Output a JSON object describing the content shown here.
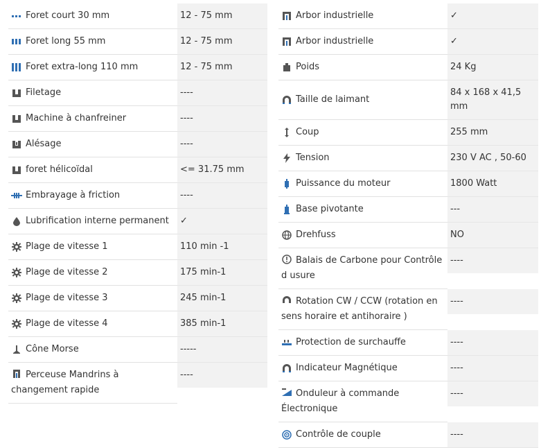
{
  "left": [
    {
      "label": "Foret court 30 mm",
      "value": "12 - 75 mm",
      "icon": "short-drill-icon"
    },
    {
      "label": "Foret long 55 mm",
      "value": "12 - 75 mm",
      "icon": "long-drill-icon"
    },
    {
      "label": "Foret extra-long 110 mm",
      "value": "12 - 75 mm",
      "icon": "extra-long-drill-icon"
    },
    {
      "label": "Filetage",
      "value": "----",
      "icon": "threading-icon"
    },
    {
      "label": "Machine à chanfreiner",
      "value": "----",
      "icon": "chamfer-icon"
    },
    {
      "label": "Alésage",
      "value": "----",
      "icon": "reaming-icon"
    },
    {
      "label": "foret hélicoïdal",
      "value": "<= 31.75 mm",
      "icon": "twist-drill-icon"
    },
    {
      "label": "Embrayage à friction",
      "value": "----",
      "icon": "friction-clutch-icon"
    },
    {
      "label": "Lubrification interne permanent",
      "value": "✓",
      "icon": "droplet-icon"
    },
    {
      "label": "Plage de vitesse 1",
      "value": "110 min -1",
      "icon": "gear-icon"
    },
    {
      "label": "Plage de vitesse 2",
      "value": "175 min-1",
      "icon": "gear-icon"
    },
    {
      "label": "Plage de vitesse 3",
      "value": "245 min-1",
      "icon": "gear-icon"
    },
    {
      "label": "Plage de vitesse 4",
      "value": "385 min-1",
      "icon": "gear-icon"
    },
    {
      "label": "Cône Morse",
      "value": "-----",
      "icon": "morse-taper-icon"
    },
    {
      "label": "Perceuse Mandrins à changement rapide",
      "value": "----",
      "icon": "quick-chuck-icon"
    }
  ],
  "right": [
    {
      "label": "Arbor industrielle",
      "value": "✓",
      "icon": "arbor-icon"
    },
    {
      "label": "Arbor industrielle",
      "value": "✓",
      "icon": "arbor-icon"
    },
    {
      "label": "Poids",
      "value": "24 Kg",
      "icon": "weight-icon"
    },
    {
      "label": "Taille de laimant",
      "value": "84 x 168 x 41,5 mm",
      "icon": "magnet-icon"
    },
    {
      "label": "Coup",
      "value": "255 mm",
      "icon": "stroke-icon"
    },
    {
      "label": "Tension",
      "value": "230 V AC , 50-60",
      "icon": "lightning-icon"
    },
    {
      "label": "Puissance du moteur",
      "value": "1800 Watt",
      "icon": "motor-icon"
    },
    {
      "label": "Base pivotante",
      "value": "---",
      "icon": "swivel-base-icon"
    },
    {
      "label": "Drehfuss",
      "value": "NO",
      "icon": "globe-icon"
    },
    {
      "label": "Balais de Carbone pour Contrôle d usure",
      "value": "----",
      "icon": "alert-circle-icon"
    },
    {
      "label": "Rotation CW / CCW (rotation en sens horaire et antihoraire )",
      "value": "----",
      "icon": "rotation-icon"
    },
    {
      "label": "Protection de surchauffe",
      "value": "----",
      "icon": "overheat-icon"
    },
    {
      "label": "Indicateur Magnétique",
      "value": "----",
      "icon": "magnet-icon"
    },
    {
      "label": "Onduleur à commande Électronique",
      "value": "----",
      "icon": "inverter-icon"
    },
    {
      "label": "Contrôle de couple",
      "value": "----",
      "icon": "torque-icon"
    }
  ],
  "colors": {
    "icon": "#555555",
    "icon_blue": "#2f6fb3",
    "row_value_bg": "#f2f2f2",
    "border": "#e1e1e1"
  }
}
